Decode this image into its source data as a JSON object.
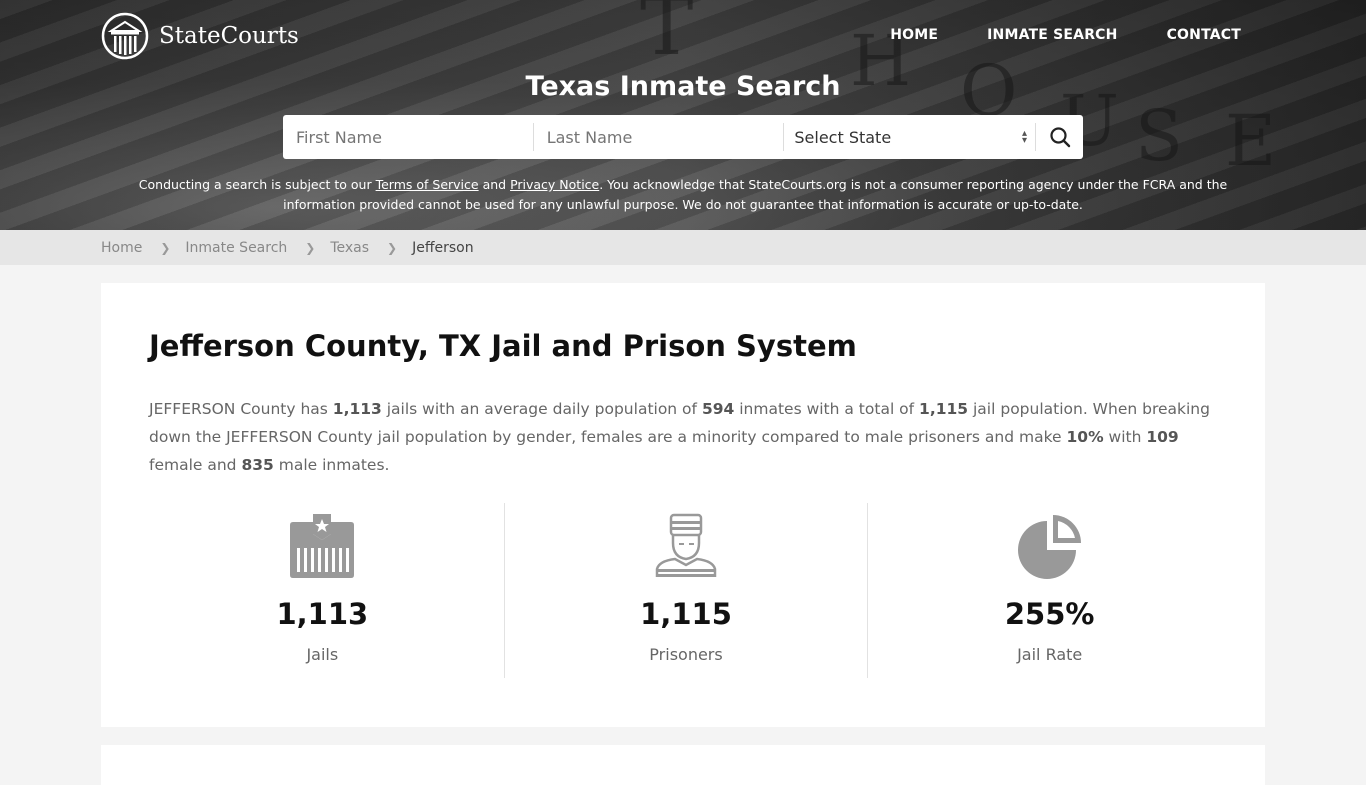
{
  "brand": {
    "name": "StateCourts"
  },
  "nav": {
    "items": [
      "HOME",
      "INMATE SEARCH",
      "CONTACT"
    ]
  },
  "hero": {
    "title": "Texas Inmate Search",
    "search": {
      "first_name_placeholder": "First Name",
      "last_name_placeholder": "Last Name",
      "state_select": "Select State",
      "search_icon": "search-icon"
    },
    "disclaimer": {
      "part1": "Conducting a search is subject to our ",
      "terms_link": "Terms of Service",
      "part2": " and ",
      "privacy_link": "Privacy Notice",
      "part3": ". You acknowledge that StateCourts.org is not a consumer reporting agency under the FCRA and the information provided cannot be used for any unlawful purpose. We do not guarantee that information is accurate or up-to-date."
    }
  },
  "breadcrumb": [
    "Home",
    "Inmate Search",
    "Texas",
    "Jefferson"
  ],
  "main": {
    "title": "Jefferson County, TX Jail and Prison System",
    "intro": {
      "t1": "JEFFERSON County has ",
      "jails": "1,113",
      "t2": " jails with an average daily population of ",
      "adp": "594",
      "t3": " inmates with a total of ",
      "total": "1,115",
      "t4": " jail population. When breaking down the JEFFERSON County jail population by gender, females are a minority compared to male prisoners and make ",
      "female_pct": "10%",
      "t5": " with ",
      "female": "109",
      "t6": " female and ",
      "male": "835",
      "t7": " male inmates."
    },
    "stats": [
      {
        "icon": "jail-icon",
        "value": "1,113",
        "label": "Jails"
      },
      {
        "icon": "prisoner-icon",
        "value": "1,115",
        "label": "Prisoners"
      },
      {
        "icon": "pie-chart-icon",
        "value": "255%",
        "label": "Jail Rate"
      }
    ]
  }
}
